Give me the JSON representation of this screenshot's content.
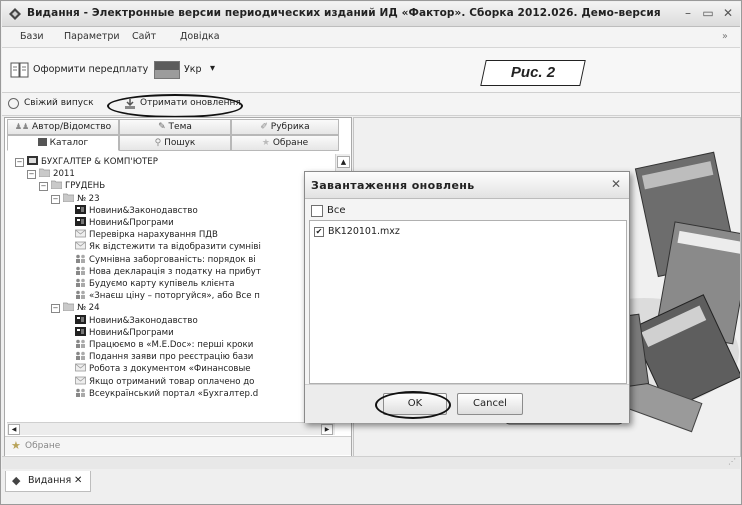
{
  "window": {
    "title": "Видання - Электронные версии периодических изданий ИД «Фактор». Сборка 2012.026. Демо-версия",
    "minimize": "–",
    "maximize": "▭",
    "close": "✕"
  },
  "menu": {
    "items": [
      "Бази",
      "Параметри",
      "Сайт",
      "Довідка"
    ],
    "overflow": "»"
  },
  "toolbar": {
    "subscribe_label": "Оформити передплату",
    "language_label": "Укр",
    "language_arrow": "▾"
  },
  "annotation": {
    "label": "Рис. 2"
  },
  "subbar": {
    "fresh_issue_label": "Свіжий випуск",
    "get_updates_label": "Отримати оновлення"
  },
  "left_panel": {
    "tabs_row1": [
      "Автор/Відомство",
      "Тема",
      "Рубрика"
    ],
    "tabs_row2": [
      "Каталог",
      "Пошук",
      "Обране"
    ],
    "active_tab": "Каталог",
    "tree": [
      {
        "label": "БУХГАЛТЕР & КОМП'ЮТЕР",
        "level": 0,
        "kind": "magazine",
        "expander": "−"
      },
      {
        "label": "2011",
        "level": 1,
        "kind": "folder",
        "expander": "−"
      },
      {
        "label": "ГРУДЕНЬ",
        "level": 2,
        "kind": "folder",
        "expander": "−"
      },
      {
        "label": "№ 23",
        "level": 3,
        "kind": "folder",
        "expander": "−"
      },
      {
        "label": "Новини&Законодавство",
        "level": 4,
        "kind": "news"
      },
      {
        "label": "Новини&Програми",
        "level": 4,
        "kind": "news"
      },
      {
        "label": "Перевірка нарахування ПДВ",
        "level": 4,
        "kind": "mail"
      },
      {
        "label": "Як відстежити та відобразити сумніві",
        "level": 4,
        "kind": "mail"
      },
      {
        "label": "Сумнівна заборгованість: порядок ві",
        "level": 4,
        "kind": "people"
      },
      {
        "label": "Нова декларація з податку на прибут",
        "level": 4,
        "kind": "people"
      },
      {
        "label": "Будуємо карту купівель клієнта",
        "level": 4,
        "kind": "people"
      },
      {
        "label": "«Знаєш ціну – поторгуйся», або Все п",
        "level": 4,
        "kind": "people"
      },
      {
        "label": "№ 24",
        "level": 3,
        "kind": "folder",
        "expander": "−"
      },
      {
        "label": "Новини&Законодавство",
        "level": 4,
        "kind": "news"
      },
      {
        "label": "Новини&Програми",
        "level": 4,
        "kind": "news"
      },
      {
        "label": "Працюємо в «M.E.Doc»: перші кроки",
        "level": 4,
        "kind": "people"
      },
      {
        "label": "Подання заяви про реєстрацію бази",
        "level": 4,
        "kind": "people"
      },
      {
        "label": "Робота з документом «Финансовые",
        "level": 4,
        "kind": "mail"
      },
      {
        "label": "Якщо отриманий товар оплачено до",
        "level": 4,
        "kind": "mail"
      },
      {
        "label": "Всеукраїнський портал «Бухгалтер.d",
        "level": 4,
        "kind": "people"
      }
    ],
    "favorites_label": "Обране"
  },
  "bottom": {
    "tab_label": "Видання",
    "tab_close": "✕"
  },
  "dialog": {
    "title": "Завантаження оновлень",
    "close": "✕",
    "select_all_label": "Все",
    "select_all_checked": false,
    "files": [
      {
        "name": "BK120101.mxz",
        "checked": true,
        "mark": "✔"
      }
    ],
    "ok_label": "OK",
    "cancel_label": "Cancel"
  },
  "colors": {
    "accent": "#d8262b",
    "folder": "#b5b5b5",
    "panel_bg": "#efefef"
  }
}
